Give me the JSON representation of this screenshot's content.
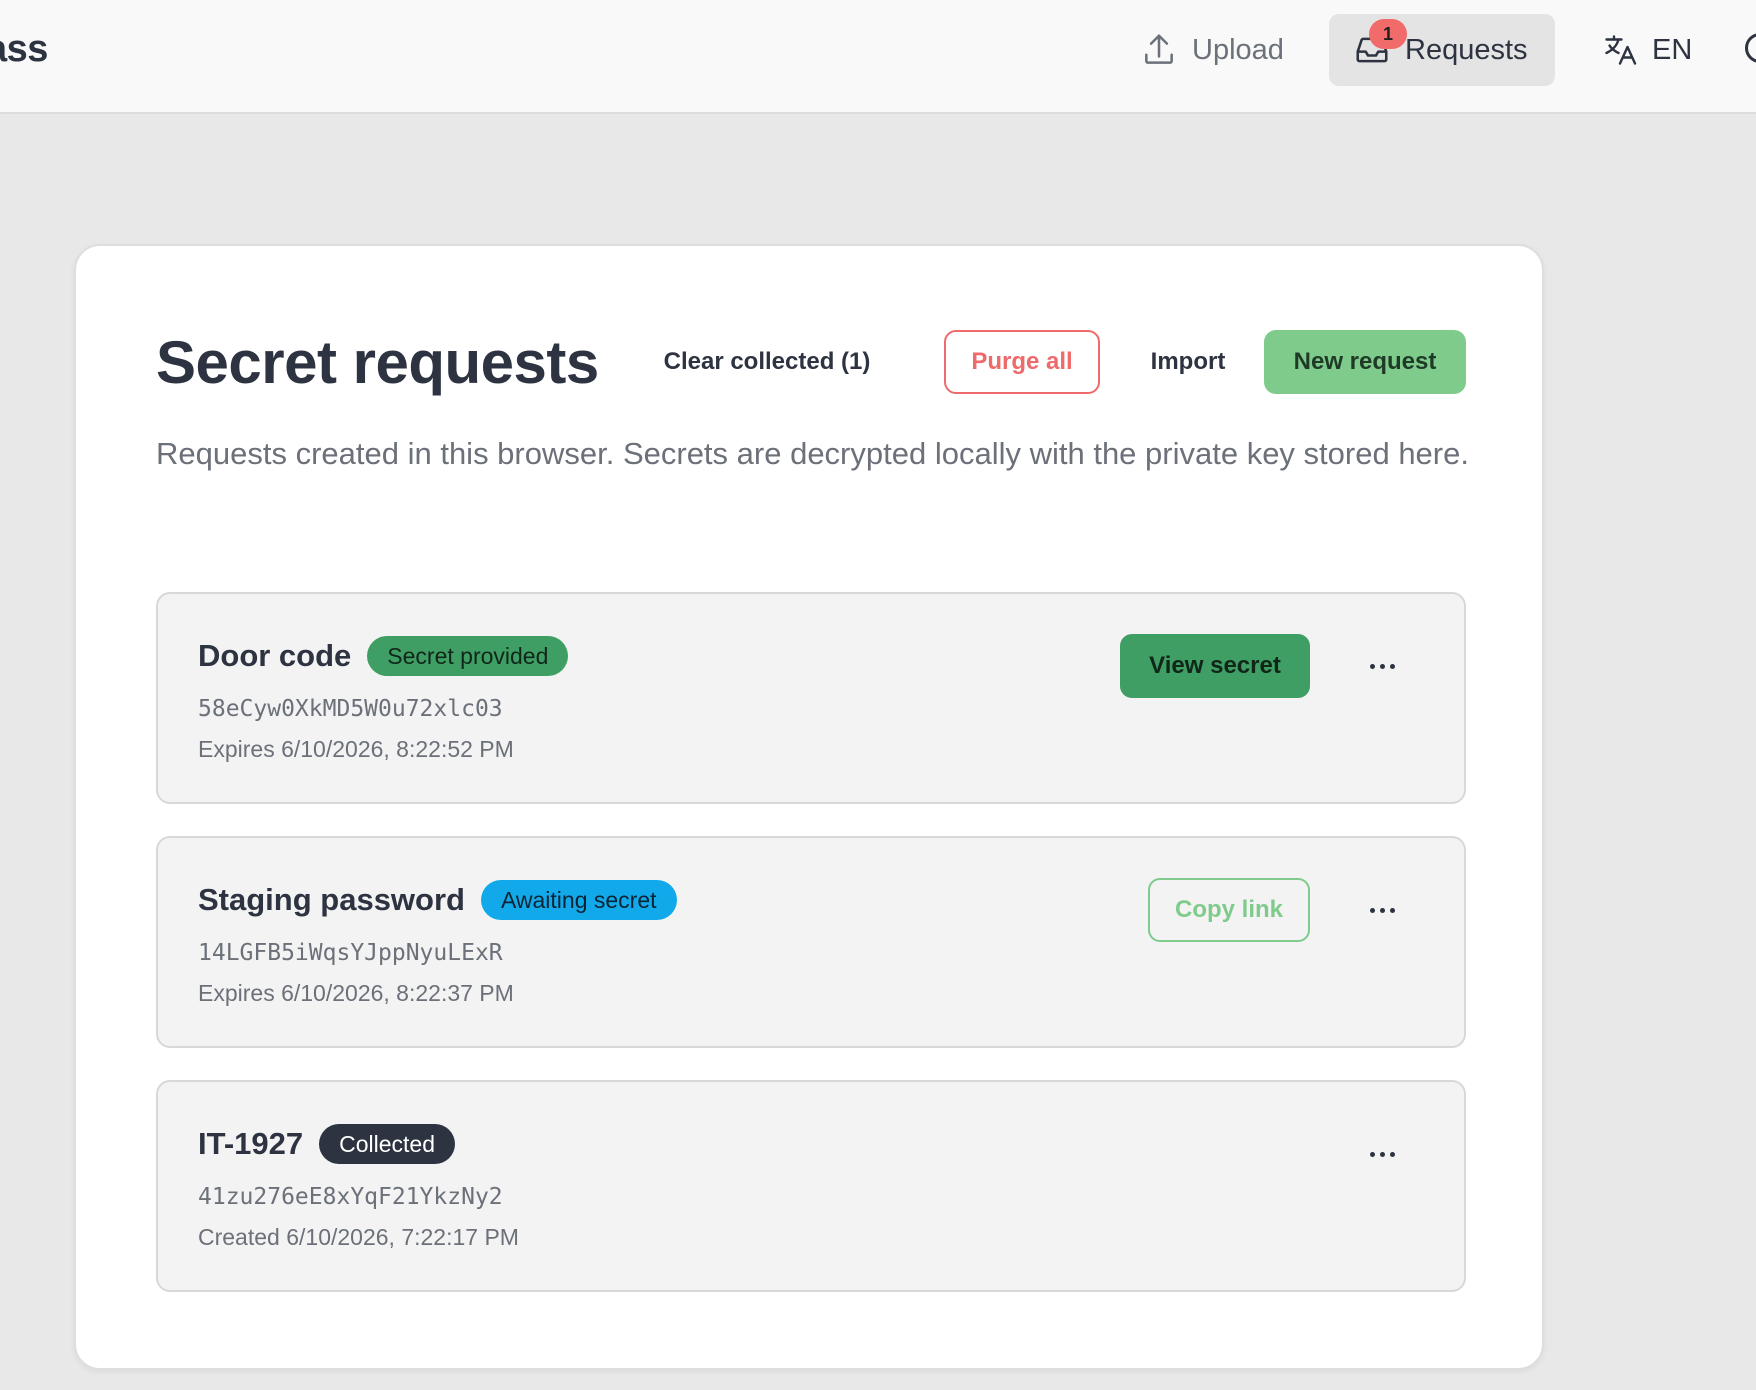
{
  "header": {
    "brand": "ass",
    "nav": {
      "upload_label": "Upload",
      "requests_label": "Requests",
      "requests_badge": "1",
      "language_label": "EN"
    }
  },
  "page": {
    "title": "Secret requests",
    "actions": {
      "clear_collected": "Clear collected (1)",
      "purge_all": "Purge all",
      "import": "Import",
      "new_request": "New request"
    },
    "description": "Requests created in this browser. Secrets are decrypted locally with the private key stored here."
  },
  "requests": [
    {
      "name": "Door code",
      "status": "Secret provided",
      "id": "58eCyw0XkMD5W0u72xlc03",
      "meta": "Expires 6/10/2026, 8:22:52 PM",
      "action": "View secret"
    },
    {
      "name": "Staging password",
      "status": "Awaiting secret",
      "id": "14LGFB5iWqsYJppNyuLExR",
      "meta": "Expires 6/10/2026, 8:22:37 PM",
      "action": "Copy link"
    },
    {
      "name": "IT-1927",
      "status": "Collected",
      "id": "41zu276eE8xYqF21YkzNy2",
      "meta": "Created 6/10/2026, 7:22:17 PM"
    }
  ],
  "colors": {
    "accent_green": "#7fcb8c",
    "provided_green": "#3f9e63",
    "awaiting_blue": "#12a9ea",
    "danger_red": "#ef6a6a",
    "collected_dark": "#2d3340"
  },
  "icons": {
    "upload": "upload-icon",
    "requests": "inbox-icon",
    "language": "translate-icon",
    "more": "more-horizontal-icon"
  }
}
